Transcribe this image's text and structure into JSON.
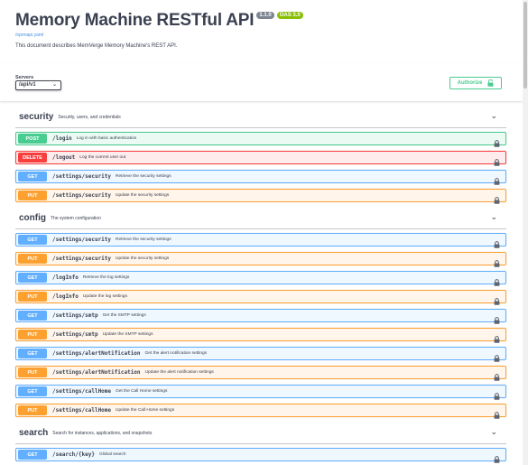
{
  "info": {
    "title": "Memory Machine RESTful API",
    "version": "1.1.0",
    "oas": "OAS 3.0",
    "spec_link": "/openapi.yaml",
    "description": "This document describes MemVerge Memory Machine's REST API."
  },
  "scheme": {
    "servers_label": "Servers",
    "server_value": "/api/v1",
    "authorize_label": "Authorize"
  },
  "tags": [
    {
      "name": "security",
      "description": "Security, users, and credentials",
      "ops": [
        {
          "method": "POST",
          "path": "/login",
          "summary": "Log in with basic authentication"
        },
        {
          "method": "DELETE",
          "path": "/logout",
          "summary": "Log the current user out"
        },
        {
          "method": "GET",
          "path": "/settings/security",
          "summary": "Retrieve the security settings"
        },
        {
          "method": "PUT",
          "path": "/settings/security",
          "summary": "Update the security settings"
        }
      ]
    },
    {
      "name": "config",
      "description": "The system configuration",
      "ops": [
        {
          "method": "GET",
          "path": "/settings/security",
          "summary": "Retrieve the security settings"
        },
        {
          "method": "PUT",
          "path": "/settings/security",
          "summary": "Update the security settings"
        },
        {
          "method": "GET",
          "path": "/logInfo",
          "summary": "Retrieve the log settings"
        },
        {
          "method": "PUT",
          "path": "/logInfo",
          "summary": "Update the log settings"
        },
        {
          "method": "GET",
          "path": "/settings/smtp",
          "summary": "Get the SMTP settings"
        },
        {
          "method": "PUT",
          "path": "/settings/smtp",
          "summary": "Update the SMTP settings"
        },
        {
          "method": "GET",
          "path": "/settings/alertNotification",
          "summary": "Get the alert notification settings"
        },
        {
          "method": "PUT",
          "path": "/settings/alertNotification",
          "summary": "Update the alert notification settings"
        },
        {
          "method": "GET",
          "path": "/settings/callHome",
          "summary": "Get the Call Home settings"
        },
        {
          "method": "PUT",
          "path": "/settings/callHome",
          "summary": "Update the Call Home settings"
        }
      ]
    },
    {
      "name": "search",
      "description": "Search for instances, applications, and snapshots",
      "ops": [
        {
          "method": "GET",
          "path": "/search/{key}",
          "summary": "Global search"
        }
      ]
    }
  ],
  "colors": {
    "get": "#61affe",
    "post": "#49cc90",
    "put": "#fca130",
    "delete": "#f93e3e"
  }
}
